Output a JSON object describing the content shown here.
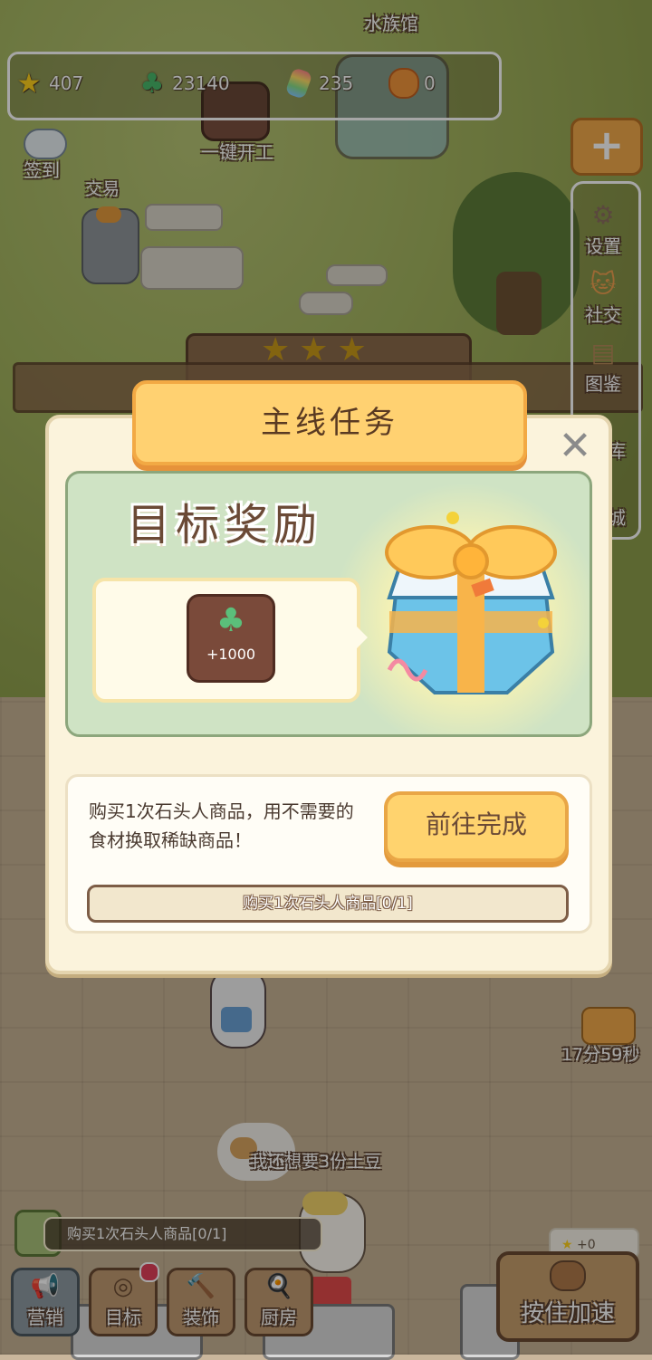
{
  "resources": {
    "stars": "407",
    "clover": "23140",
    "candy": "235",
    "cookie": "0"
  },
  "scene": {
    "aquarium": "水族馆",
    "one_key_start": "一键开工",
    "checkin": "签到",
    "trade": "交易",
    "timer": "17分59秒",
    "thought": "我还想要3份土豆",
    "mini_star_count": "+0"
  },
  "side_menu": {
    "plus": "+",
    "items": [
      {
        "label": "设置",
        "icon": "gear-icon"
      },
      {
        "label": "社交",
        "icon": "cat-icon"
      },
      {
        "label": "图鉴",
        "icon": "book-icon"
      },
      {
        "label": "库",
        "icon": "warehouse-icon"
      },
      {
        "label": "城",
        "icon": "shop-icon"
      }
    ]
  },
  "dialog": {
    "title": "主线任务",
    "close": "✕",
    "reward_heading": "目标奖励",
    "reward_amount": "+1000",
    "task_description": "购买1次石头人商品，用不需要的食材换取稀缺商品！",
    "go_button": "前往完成",
    "progress_text": "购买1次石头人商品[0/1]"
  },
  "bottom": {
    "task_banner": "购买1次石头人商品[0/1]",
    "buttons": [
      {
        "label": "营销",
        "icon": "megaphone-icon"
      },
      {
        "label": "目标",
        "icon": "target-icon"
      },
      {
        "label": "装饰",
        "icon": "hammer-icon"
      },
      {
        "label": "厨房",
        "icon": "wok-icon"
      }
    ],
    "speed_button": "按住加速"
  },
  "colors": {
    "accent": "#ffd171",
    "accent_border": "#f2a944",
    "panel_green": "#cfe3c4",
    "text_brown": "#5a3a22"
  }
}
